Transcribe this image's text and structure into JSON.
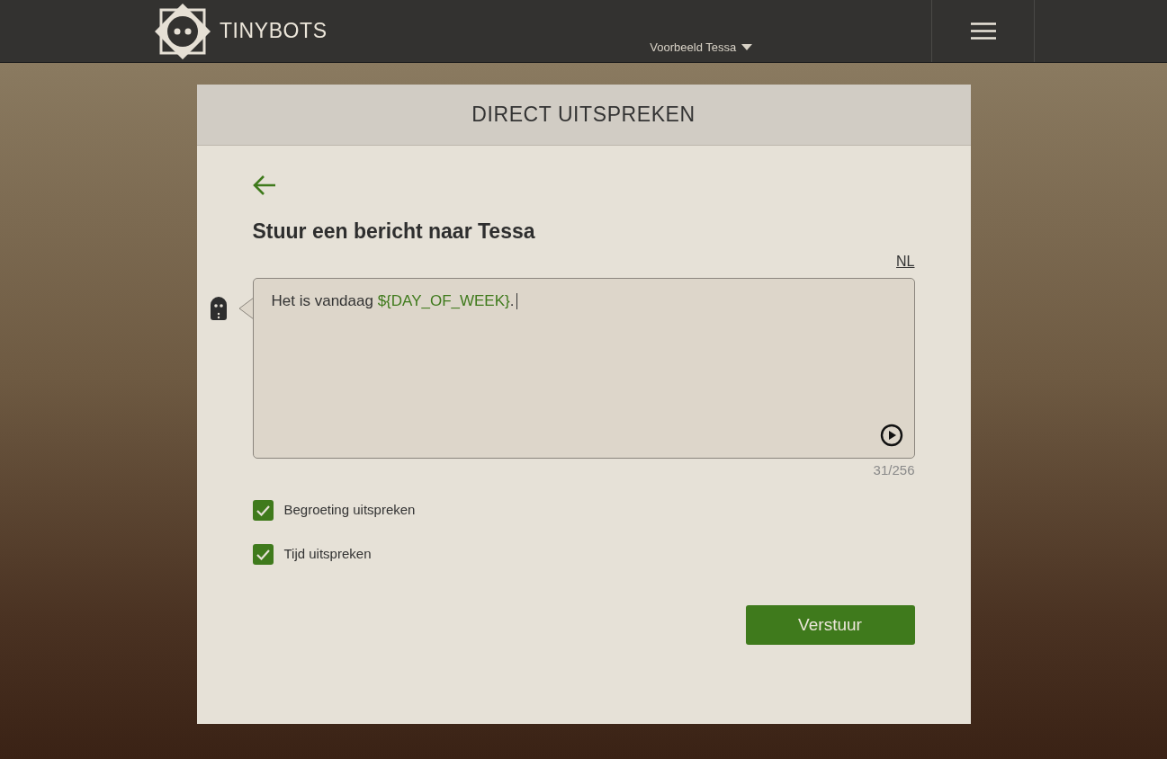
{
  "header": {
    "brand": "TINYBOTS",
    "account": "Voorbeeld Tessa"
  },
  "card": {
    "title": "DIRECT UITSPREKEN",
    "heading": "Stuur een bericht naar Tessa",
    "language": "NL",
    "message": [
      {
        "kind": "text",
        "text": "Het is vandaag "
      },
      {
        "kind": "variable",
        "text": "${DAY_OF_WEEK}"
      },
      {
        "kind": "text",
        "text": "."
      }
    ],
    "counter": "31/256",
    "options": [
      {
        "label": "Begroeting uitspreken",
        "checked": true
      },
      {
        "label": "Tijd uitspreken",
        "checked": true
      }
    ],
    "submit": "Verstuur"
  }
}
